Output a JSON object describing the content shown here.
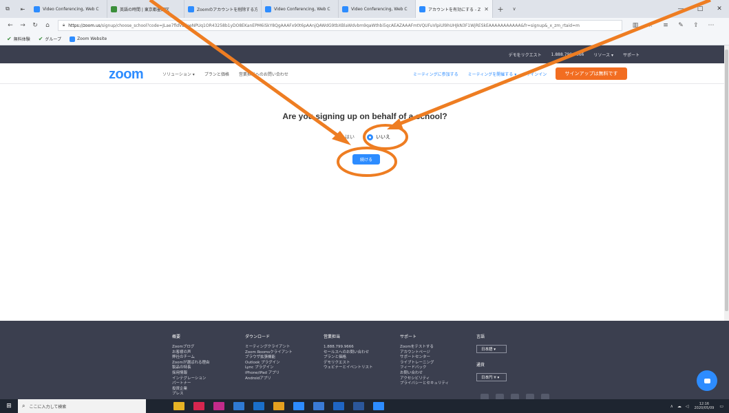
{
  "browser": {
    "tabs": [
      {
        "title": "Video Conferencing, Web C",
        "fav": "blue"
      },
      {
        "title": "英語の時間 | 東京都墨田区",
        "fav": "green"
      },
      {
        "title": "Zoomのアカウントを削除する方",
        "fav": "blue"
      },
      {
        "title": "Video Conferencing, Web C",
        "fav": "blue"
      },
      {
        "title": "Video Conferencing, Web C",
        "fav": "blue"
      },
      {
        "title": "アカウントを有効にする - Z",
        "fav": "blue",
        "active": true
      }
    ],
    "url_host": "https://zoom.us",
    "url_path": "/signup/choose_school?code=JLae7fldVBFeeNPUq1OR43258b1yDO8EKanEPM6iSkY8QgAAAFx90t6pAAnjQAWdG9tbXBlaWdvbm9qaWthbi5qcAEAZAAAFmtVQUFuVlpiUl9hUHJkN3F1WjRESkEAAAAAAAAAAA&fr=signup&_x_zm_rtaid=m",
    "favorites": [
      {
        "label": "無料体験",
        "icon": "check-green"
      },
      {
        "label": "グループ",
        "icon": "check-green"
      },
      {
        "label": "Zoom Website",
        "icon": "zoom-blue"
      }
    ]
  },
  "zoom": {
    "topstrip": [
      "デモをリクエスト",
      "1.888.799.9666",
      "リソース ▾",
      "サポート"
    ],
    "logo": "zoom",
    "nav_left": [
      "ソリューション ▾",
      "プランと価格",
      "営業担当へのお問い合わせ"
    ],
    "nav_right": [
      "ミーティングに参加する",
      "ミーティングを開催する ▾",
      "サインイン"
    ],
    "signup_button": "サインアップは無料です"
  },
  "main": {
    "question": "Are you signing up on behalf of a school?",
    "option_yes": "はい",
    "option_no": "いいえ",
    "selected": "no",
    "continue_button": "続ける"
  },
  "footer": {
    "columns": [
      {
        "heading": "概要",
        "items": [
          "Zoomブログ",
          "お客様の声",
          "弊社のチーム",
          "Zoomが選ばれる理由",
          "製品の特長",
          "採用情報",
          "インテグレーション",
          "パートナー",
          "投資企業",
          "プレス"
        ]
      },
      {
        "heading": "ダウンロード",
        "items": [
          "ミーティングクライアント",
          "Zoom Roomsクライアント",
          "ブラウザ拡張機能",
          "Outlook プラグイン",
          "Lync プラグイン",
          "iPhone/iPad アプリ",
          "Androidアプリ"
        ]
      },
      {
        "heading": "営業担当",
        "items": [
          "1.888.799.9666",
          "セールスへのお問い合わせ",
          "プランと価格",
          "デモリクエスト",
          "ウェビナーとイベントリスト"
        ]
      },
      {
        "heading": "サポート",
        "items": [
          "Zoomをテストする",
          "アカウントページ",
          "サポートセンター",
          "ライブトレーニング",
          "フィードバック",
          "お問い合わせ",
          "アクセシビリティ",
          "プライバシーとセキュリティ"
        ]
      }
    ],
    "language_heading": "言語",
    "language_value": "日本語 ▾",
    "currency_heading": "通貨",
    "currency_value": "日本円 ¥ ▾"
  },
  "taskbar": {
    "search_placeholder": "ここに入力して検索",
    "time": "12:16",
    "date": "2020/05/09"
  }
}
